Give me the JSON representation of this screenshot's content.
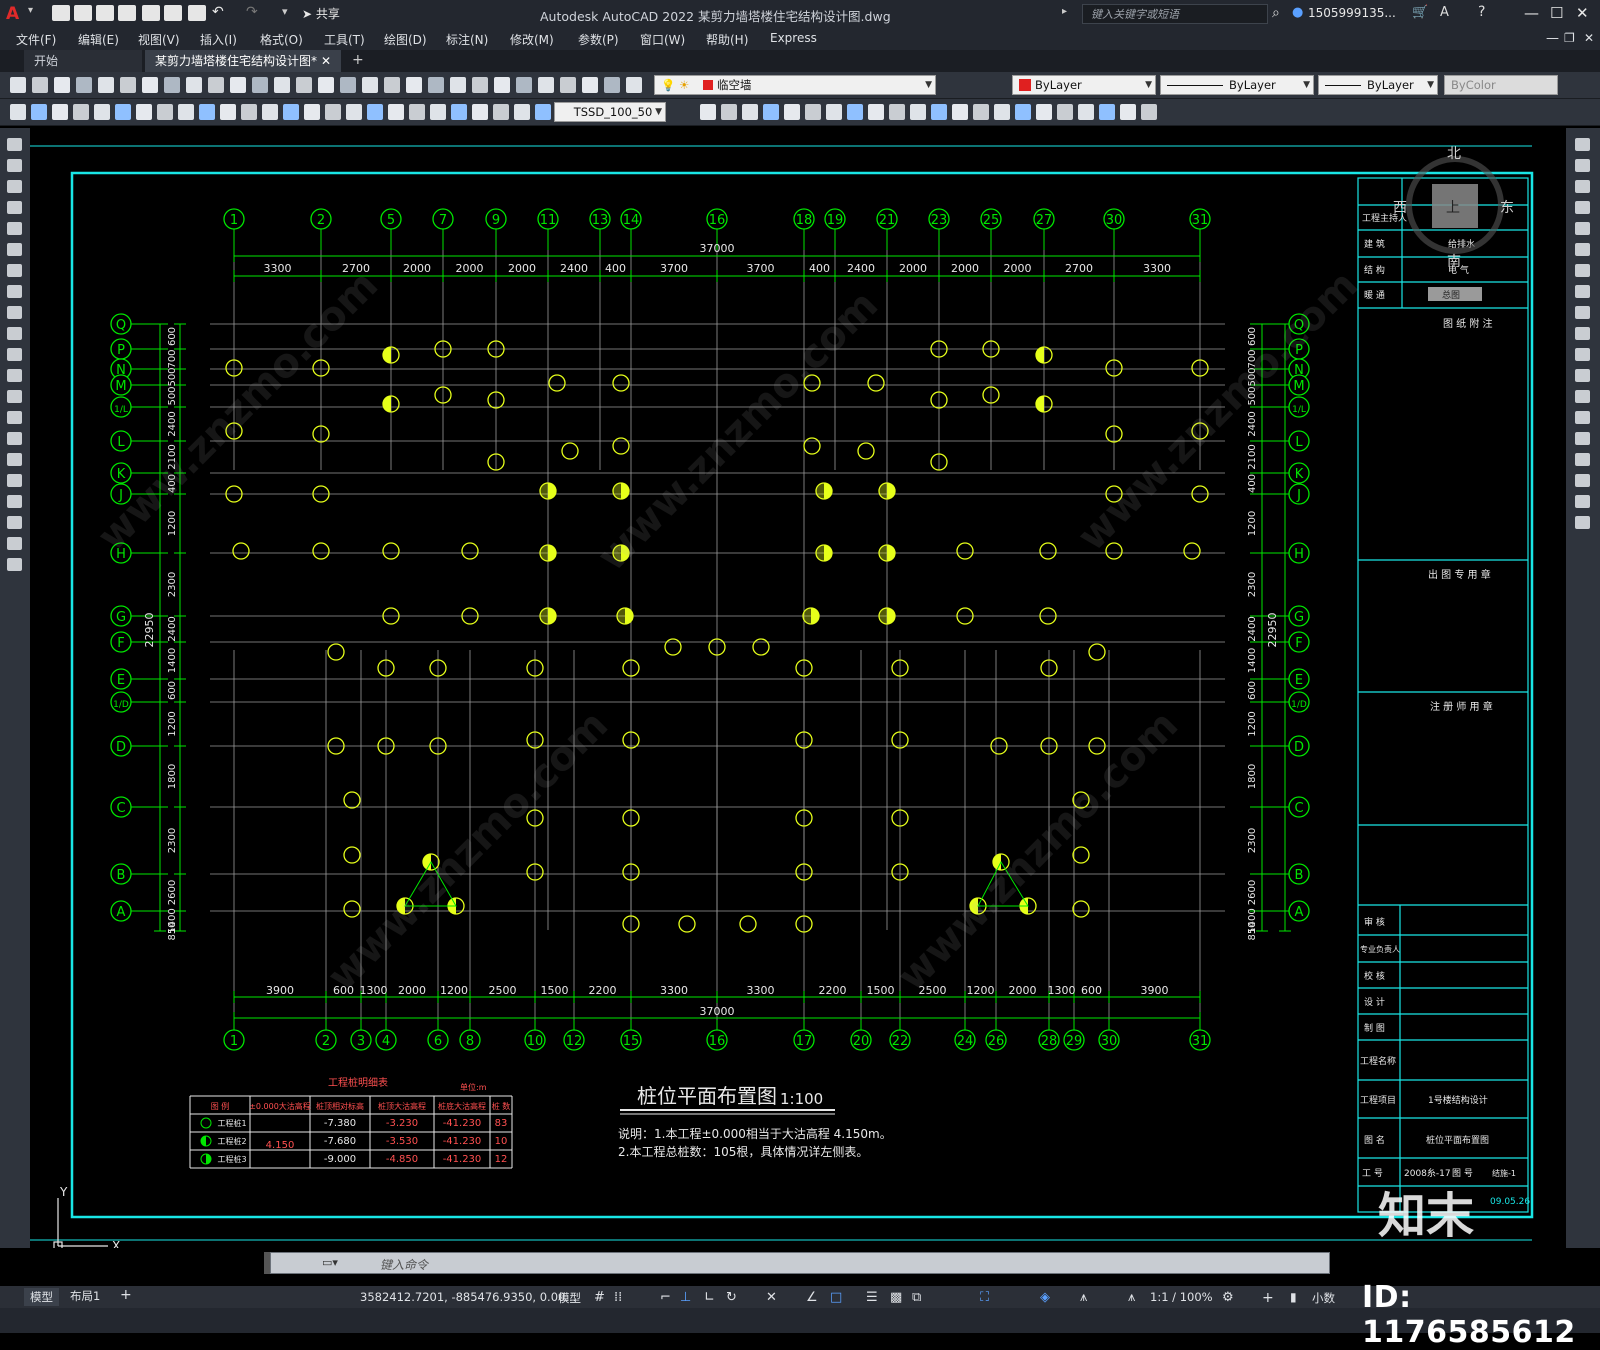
{
  "app": {
    "title": "Autodesk AutoCAD 2022    某剪力墙塔楼住宅结构设计图.dwg",
    "share_label": "共享",
    "search_placeholder": "键入关键字或短语",
    "user": "1505999135...",
    "accent": "#00ff00"
  },
  "menu": [
    "文件(F)",
    "编辑(E)",
    "视图(V)",
    "插入(I)",
    "格式(O)",
    "工具(T)",
    "绘图(D)",
    "标注(N)",
    "修改(M)",
    "参数(P)",
    "窗口(W)",
    "帮助(H)",
    "Express"
  ],
  "tabs": [
    {
      "label": "开始"
    },
    {
      "label": "某剪力墙塔楼住宅结构设计图*"
    }
  ],
  "toolbar": {
    "layer_name": "临空墙",
    "color": "ByLayer",
    "linetype": "ByLayer",
    "lineweight": "ByLayer",
    "plotstyle": "ByColor",
    "dimstyle": "TSSD_100_50"
  },
  "compass": {
    "north": "北",
    "south": "南",
    "east": "东",
    "west": "西",
    "top": "上"
  },
  "drawing": {
    "top_axes": [
      "1",
      "2",
      "5",
      "7",
      "9",
      "11",
      "13",
      "14",
      "16",
      "18",
      "19",
      "21",
      "23",
      "25",
      "27",
      "30",
      "31"
    ],
    "bottom_axes": [
      "1",
      "2",
      "3",
      "4",
      "6",
      "8",
      "10",
      "12",
      "15",
      "16",
      "17",
      "20",
      "22",
      "24",
      "26",
      "28",
      "29",
      "30",
      "31"
    ],
    "left_axes": [
      "Q",
      "P",
      "N",
      "M",
      "1/L",
      "L",
      "K",
      "J",
      "H",
      "G",
      "F",
      "E",
      "1/D",
      "D",
      "C",
      "B",
      "A"
    ],
    "top_total": "37000",
    "top_dims": [
      "3300",
      "2700",
      "2000",
      "2000",
      "2000",
      "2400",
      "400",
      "3700",
      "3700",
      "400",
      "2400",
      "2000",
      "2000",
      "2000",
      "2700",
      "3300"
    ],
    "bottom_total": "37000",
    "bottom_dims": [
      "3900",
      "600",
      "1300",
      "2000",
      "1200",
      "2500",
      "1500",
      "2200",
      "3300",
      "3300",
      "2200",
      "1500",
      "2500",
      "1200",
      "2000",
      "1300",
      "600",
      "3900"
    ],
    "left_total": "22950",
    "left_dims": [
      "600",
      "700",
      "500",
      "500",
      "2400",
      "2100",
      "400",
      "1200",
      "2300",
      "2400",
      "1400",
      "600",
      "1200",
      "1800",
      "2300",
      "2600",
      "1400",
      "850"
    ],
    "drawing_title": "桩位平面布置图",
    "scale": "1:100",
    "notes": [
      "说明：1.本工程±0.000相当于大沽高程 4.150m。",
      "2.本工程总桩数：105根，具体情况详左侧表。"
    ],
    "pile_table": {
      "title": "工程桩明细表",
      "unit": "单位:m",
      "headers": [
        "图 例",
        "±0.000大沽高程",
        "桩顶相对标高",
        "桩顶大沽高程",
        "桩底大沽高程",
        "桩 数"
      ],
      "rows": [
        {
          "type": "工程桩1",
          "elev": "4.150",
          "rel": "-7.380",
          "top": "-3.230",
          "bottom": "-41.230",
          "count": "83"
        },
        {
          "type": "工程桩2",
          "elev": "",
          "rel": "-7.680",
          "top": "-3.530",
          "bottom": "-41.230",
          "count": "10"
        },
        {
          "type": "工程桩3",
          "elev": "",
          "rel": "-9.000",
          "top": "-4.850",
          "bottom": "-41.230",
          "count": "12"
        }
      ]
    }
  },
  "titleblock": {
    "rows_top": [
      "工程主持人",
      "建 筑",
      "结 构",
      "暖 通"
    ],
    "right_top": [
      "给排水",
      "电 气",
      "总图"
    ],
    "sections": [
      "图 纸 附 注",
      "出 图 专 用 章",
      "注 册 师 用 章"
    ],
    "sign_rows": [
      "审 核",
      "专业负责人",
      "校 核",
      "设 计",
      "制 图"
    ],
    "project_name_label": "工程名称",
    "project_item_label": "工程项目",
    "project_item": "1号楼结构设计",
    "drawing_name_label": "图 名",
    "drawing_name": "桩位平面布置图",
    "job_no_label": "工 号",
    "job_no": "2008糸-17",
    "drawing_no_label": "图 号",
    "drawing_no": "结施-1",
    "date": "09.05.26"
  },
  "command": {
    "placeholder": "键入命令"
  },
  "status": {
    "coords": "3582412.7201, -885476.9350, 0.00...",
    "model": "模型",
    "scale": "1:1 / 100%",
    "units": "小数",
    "layout_tabs": [
      "模型",
      "布局1"
    ]
  },
  "watermark": {
    "brand": "知末",
    "id": "ID: 1176585612"
  }
}
